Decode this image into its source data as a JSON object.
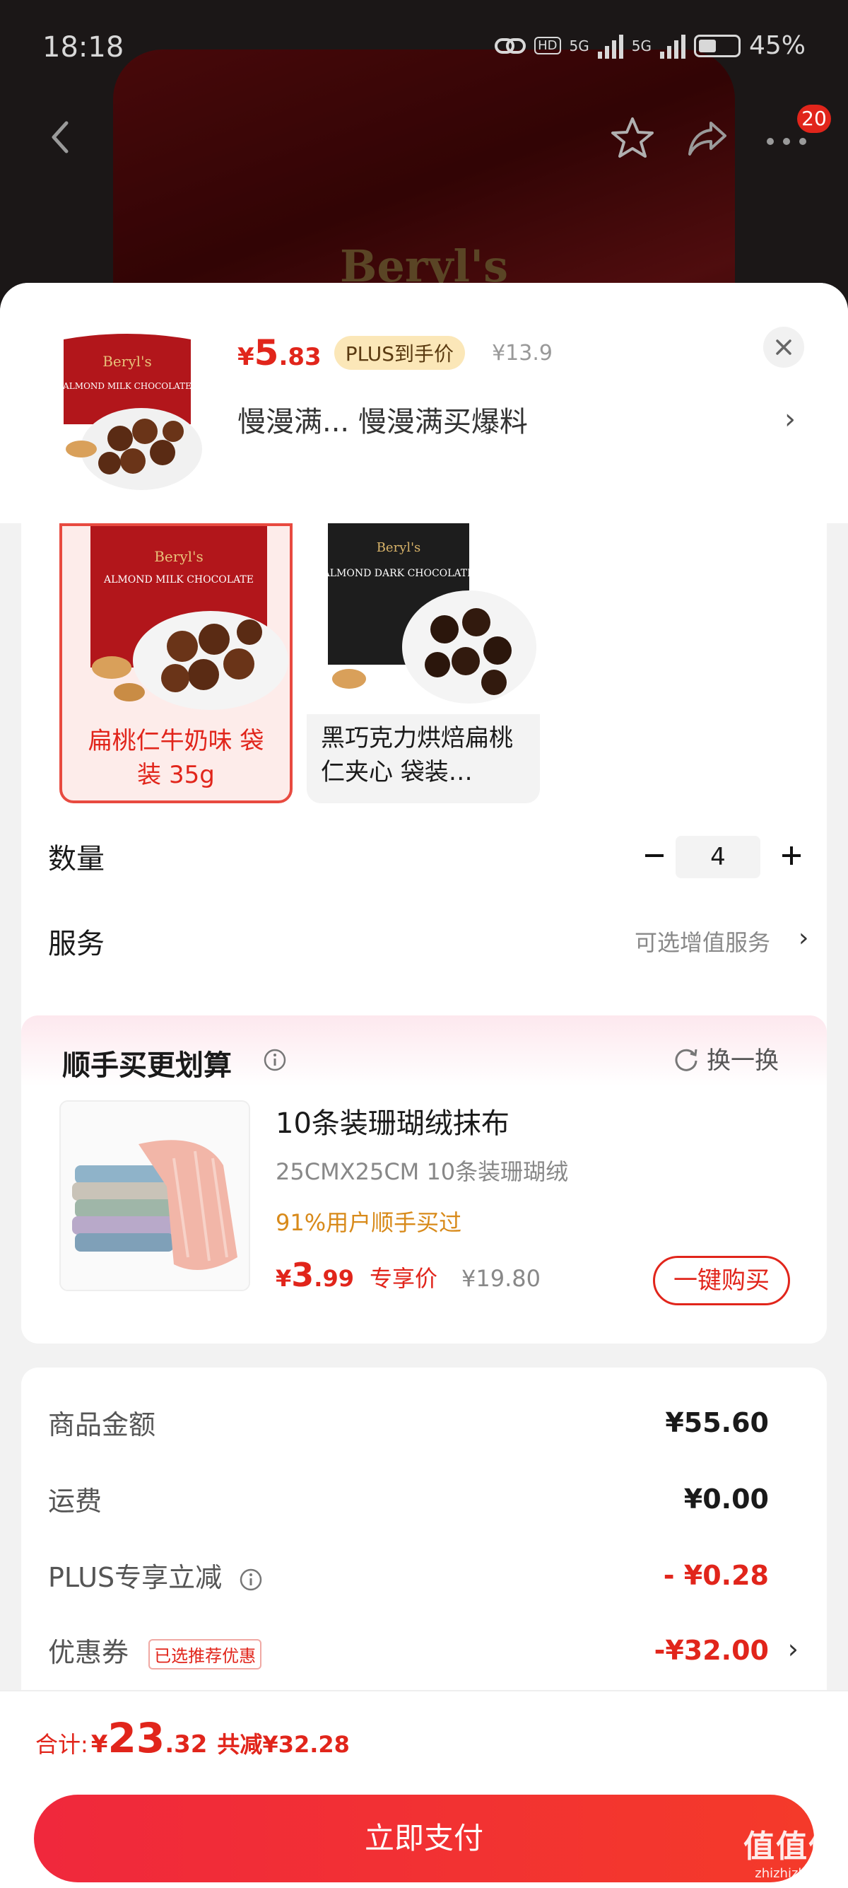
{
  "status": {
    "time": "18:18",
    "battery": "45%",
    "hd": "HD",
    "net1": "5G",
    "net2": "5G"
  },
  "nav": {
    "more_badge": "20"
  },
  "backdrop": {
    "brand": "Beryl's"
  },
  "product": {
    "price_currency": "¥",
    "price_int": "5",
    "price_dec": ".83",
    "plus_tag": "PLUS到手价",
    "orig_price": "¥13.9",
    "promo": "慢漫满...  慢漫满买爆料",
    "thumb_brand": "Beryl's",
    "thumb_name": "ALMOND MILK CHOCOLATE"
  },
  "variants": [
    {
      "name": "扁桃仁牛奶味 袋装 35g",
      "brand": "Beryl's",
      "pack": "ALMOND MILK CHOCOLATE",
      "selected": true
    },
    {
      "name": "黑巧克力烘焙扁桃仁夹心 袋装…",
      "brand": "Beryl's",
      "pack": "ALMOND DARK CHOCOLATE",
      "selected": false
    }
  ],
  "quantity": {
    "label": "数量",
    "value": "4"
  },
  "service": {
    "label": "服务",
    "hint": "可选增值服务"
  },
  "addon": {
    "title": "顺手买更划算",
    "refresh": "换一换",
    "name": "10条装珊瑚绒抹布",
    "spec": "25CMX25CM 10条装珊瑚绒",
    "buyers": "91%用户顺手买过",
    "price_currency": "¥",
    "price_int": "3",
    "price_dec": ".99",
    "tag": "专享价",
    "orig_price": "¥19.80",
    "buy_label": "一键购买"
  },
  "totals": {
    "goods_label": "商品金额",
    "goods_value": "¥55.60",
    "shipping_label": "运费",
    "shipping_value": "¥0.00",
    "plus_label": "PLUS专享立减",
    "plus_value": "- ¥0.28",
    "coupon_label": "优惠券",
    "coupon_tag": "已选推荐优惠",
    "coupon_value": "-¥32.00"
  },
  "bottom": {
    "sum_label": "合计:",
    "sum_currency": "¥",
    "sum_int": "23",
    "sum_dec": ".32",
    "sum_save": "共减¥32.28",
    "pay_label": "立即支付"
  },
  "watermark": {
    "big": "值值值",
    "small": "zhizhizhi.com"
  },
  "colors": {
    "accent": "#e1251b",
    "plus_tag_bg": "#fbe7b8",
    "buyers": "#d88a1a"
  }
}
